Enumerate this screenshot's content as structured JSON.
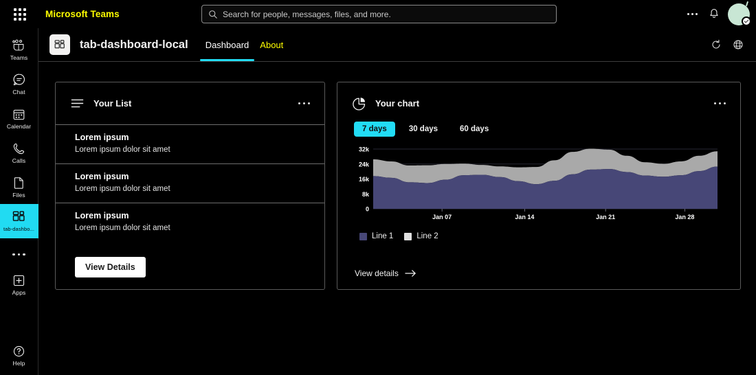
{
  "topbar": {
    "waffle_icon": "app-grid-icon",
    "brand": "Microsoft Teams",
    "brand_color": "#ffff00",
    "search": {
      "icon": "search-icon",
      "placeholder": "Search for people, messages, files, and more.",
      "value": ""
    },
    "more_icon": "ellipsis-icon",
    "notifications_icon": "bell-icon",
    "avatar_icon": "user-avatar"
  },
  "rail": {
    "items": [
      {
        "label": "Teams",
        "icon": "teams-icon",
        "active": false
      },
      {
        "label": "Chat",
        "icon": "chat-icon",
        "active": false
      },
      {
        "label": "Calendar",
        "icon": "calendar-icon",
        "active": false
      },
      {
        "label": "Calls",
        "icon": "calls-icon",
        "active": false
      },
      {
        "label": "Files",
        "icon": "files-icon",
        "active": false
      },
      {
        "label": "tab-dashbo...",
        "icon": "app-tile-icon",
        "active": true
      }
    ],
    "more_label": "More",
    "apps": {
      "label": "Apps",
      "icon": "plus-square-icon"
    },
    "help": {
      "label": "Help",
      "icon": "question-circle-icon"
    },
    "active_color": "#21dbf2"
  },
  "tabbar": {
    "app_icon": "app-tile-icon",
    "app_title": "tab-dashboard-local",
    "tabs": [
      {
        "label": "Dashboard",
        "active": true
      },
      {
        "label": "About",
        "active": false
      }
    ],
    "refresh_icon": "refresh-icon",
    "globe_icon": "globe-icon",
    "active_underline_color": "#21dbf2",
    "inactive_tab_color": "#ffff00"
  },
  "list_card": {
    "icon": "list-lines-icon",
    "title": "Your List",
    "menu_icon": "ellipsis-icon",
    "items": [
      {
        "title": "Lorem ipsum",
        "subtitle": "Lorem ipsum dolor sit amet"
      },
      {
        "title": "Lorem ipsum",
        "subtitle": "Lorem ipsum dolor sit amet"
      },
      {
        "title": "Lorem ipsum",
        "subtitle": "Lorem ipsum dolor sit amet"
      }
    ],
    "button_label": "View Details"
  },
  "chart_card": {
    "icon": "pie-chart-icon",
    "title": "Your chart",
    "menu_icon": "ellipsis-icon",
    "ranges": [
      {
        "label": "7 days",
        "active": true
      },
      {
        "label": "30 days",
        "active": false
      },
      {
        "label": "60 days",
        "active": false
      }
    ],
    "view_details_label": "View details",
    "view_details_icon": "arrow-right-icon",
    "active_pill_color": "#22dcf5"
  },
  "chart_data": {
    "type": "area",
    "stacked": true,
    "title": "Your chart",
    "xlabel": "",
    "ylabel": "",
    "ylim": [
      0,
      32000
    ],
    "yticks": [
      0,
      8000,
      16000,
      24000,
      32000
    ],
    "ytick_labels": [
      "0",
      "8k",
      "16k",
      "24k",
      "32k"
    ],
    "xticks": [
      "Jan 07",
      "Jan 14",
      "Jan 21",
      "Jan 28"
    ],
    "xtick_positions": [
      0.2,
      0.44,
      0.675,
      0.905
    ],
    "grid": true,
    "legend_position": "bottom-left",
    "series": [
      {
        "name": "Line 1",
        "color": "#474777",
        "values": [
          17500,
          16600,
          14200,
          13800,
          15600,
          18000,
          18200,
          17000,
          14800,
          13200,
          15000,
          18500,
          21000,
          21300,
          19700,
          17800,
          17200,
          18000,
          20200,
          22600
        ]
      },
      {
        "name": "Line 2",
        "color": "#a9a9a9",
        "values": [
          9000,
          8800,
          9000,
          9500,
          8400,
          6200,
          5300,
          5700,
          7400,
          9200,
          11000,
          12000,
          11200,
          10400,
          8700,
          7100,
          6900,
          7400,
          8200,
          8200
        ]
      }
    ],
    "x": [
      0,
      1,
      2,
      3,
      4,
      5,
      6,
      7,
      8,
      9,
      10,
      11,
      12,
      13,
      14,
      15,
      16,
      17,
      18,
      19
    ]
  }
}
